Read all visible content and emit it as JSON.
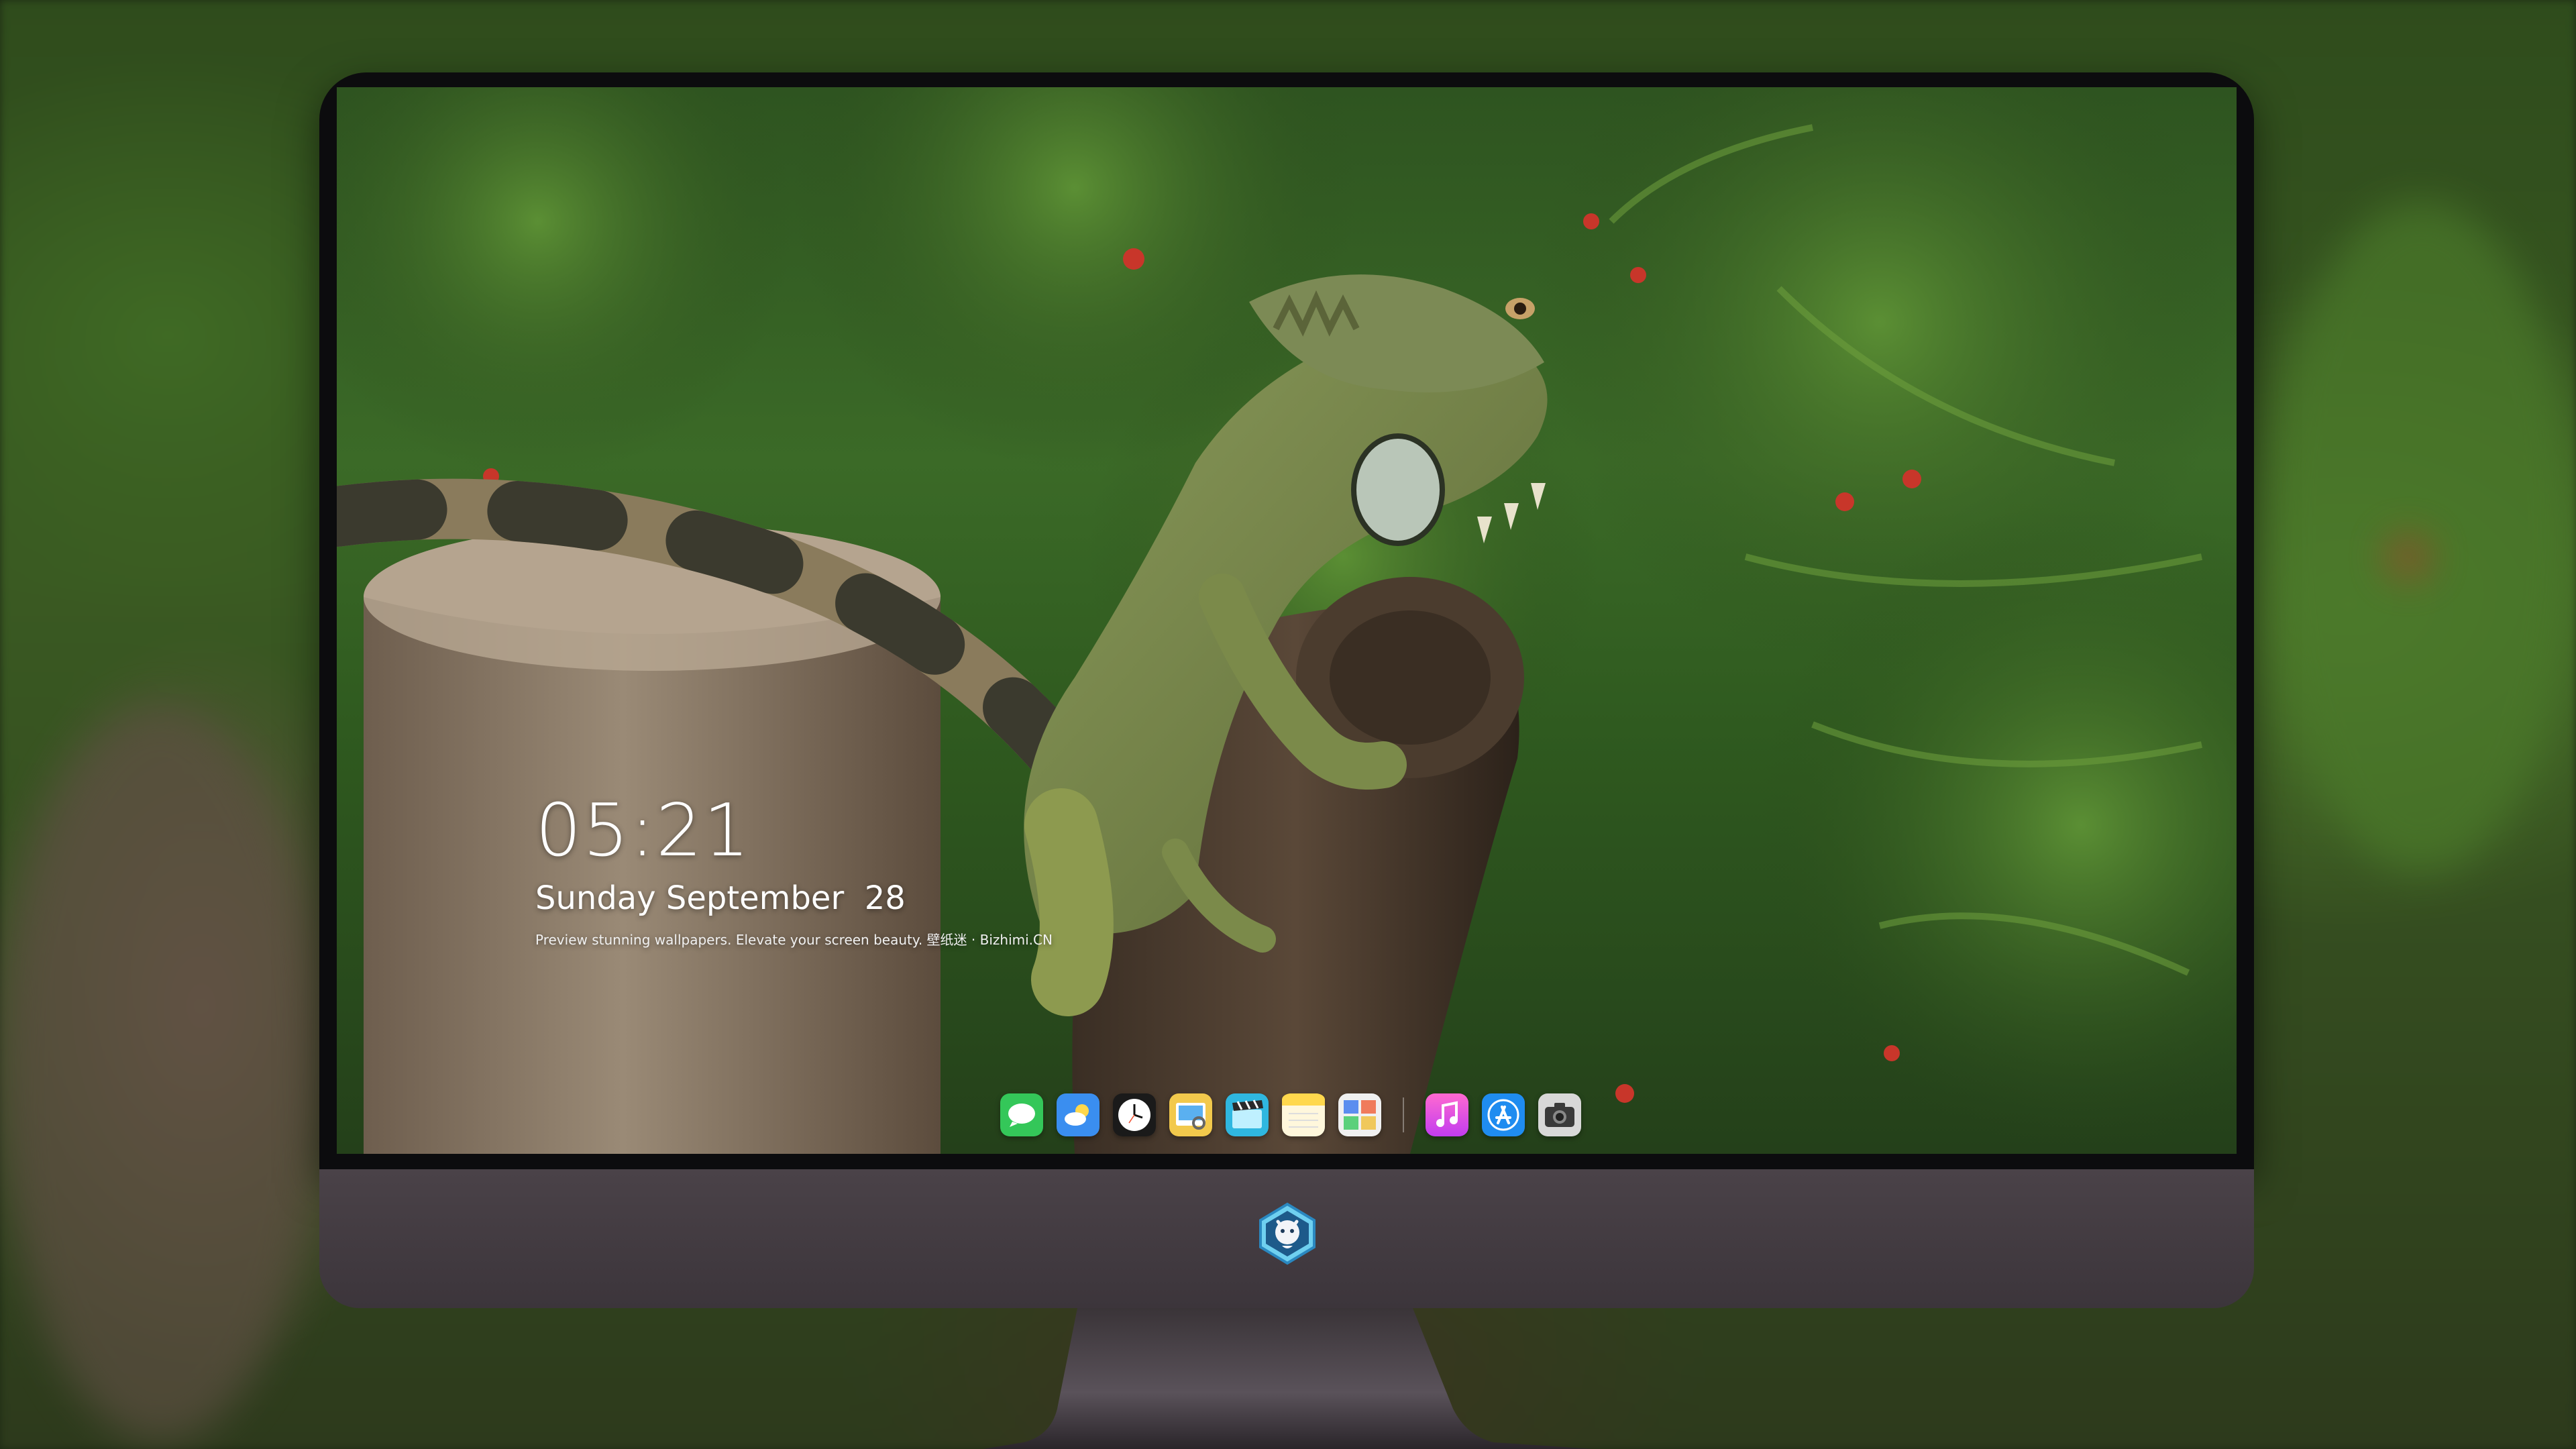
{
  "lockscreen": {
    "time": "05:21",
    "date": "Sunday September  28",
    "caption": "Preview stunning wallpapers. Elevate your screen beauty. 壁纸迷 · Bizhimi.CN"
  },
  "dock": {
    "apps": [
      {
        "icon": "messages-icon",
        "color": "#34c759"
      },
      {
        "icon": "weather-icon",
        "color": "#3a8ef0"
      },
      {
        "icon": "clock-icon",
        "color": "#ffffff"
      },
      {
        "icon": "preview-icon",
        "color": "#f2c94c"
      },
      {
        "icon": "claquette-icon",
        "color": "#2fb7e0"
      },
      {
        "icon": "notes-icon",
        "color": "#ffd84d"
      },
      {
        "icon": "photo-collage-icon",
        "color": "#5b8def"
      },
      {
        "icon": "music-icon",
        "color": "#ff4fa1"
      },
      {
        "icon": "app-store-icon",
        "color": "#1f8cf0"
      },
      {
        "icon": "camera-icon",
        "color": "#d8d8d8"
      }
    ]
  },
  "colors": {
    "bezel": "#0c0c0e",
    "chin": "#4a4248",
    "foliage": "#3b6a27",
    "stump": "#8a7863"
  }
}
